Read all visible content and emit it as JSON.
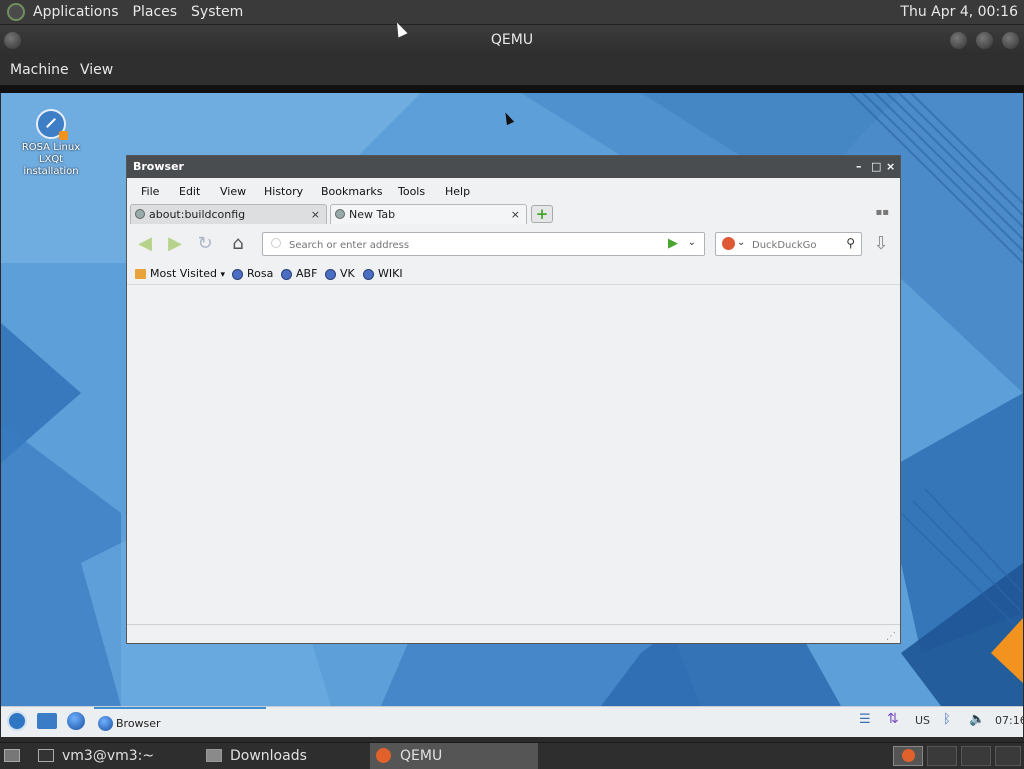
{
  "host_panel": {
    "menus": [
      "Applications",
      "Places",
      "System"
    ],
    "clock": "Thu Apr  4, 00:16"
  },
  "qemu": {
    "title": "QEMU",
    "menus": [
      "Machine",
      "View"
    ]
  },
  "desktop_icon": {
    "label_lines": [
      "ROSA Linux",
      "LXQt",
      "installation"
    ]
  },
  "browser": {
    "title": "Browser",
    "window_controls": [
      "–",
      "□",
      "×"
    ],
    "menus": [
      "File",
      "Edit",
      "View",
      "History",
      "Bookmarks",
      "Tools",
      "Help"
    ],
    "tabs": [
      {
        "label": "about:buildconfig",
        "active": false
      },
      {
        "label": "New Tab",
        "active": true
      }
    ],
    "address_placeholder": "Search or enter address",
    "search_engine_placeholder": "DuckDuckGo",
    "bookmarks": [
      {
        "label": "Most Visited"
      },
      {
        "label": "Rosa"
      },
      {
        "label": "ABF"
      },
      {
        "label": "VK"
      },
      {
        "label": "WIKI"
      }
    ]
  },
  "guest_taskbar": {
    "task_label": "Browser",
    "keyboard_layout": "US",
    "clock": "07:16"
  },
  "host_bottom": {
    "tasks": [
      "vm3@vm3:~",
      "Downloads",
      "QEMU"
    ]
  },
  "colors": {
    "desktop_blue": "#5d9fd8",
    "accent_orange": "#f2921f"
  }
}
